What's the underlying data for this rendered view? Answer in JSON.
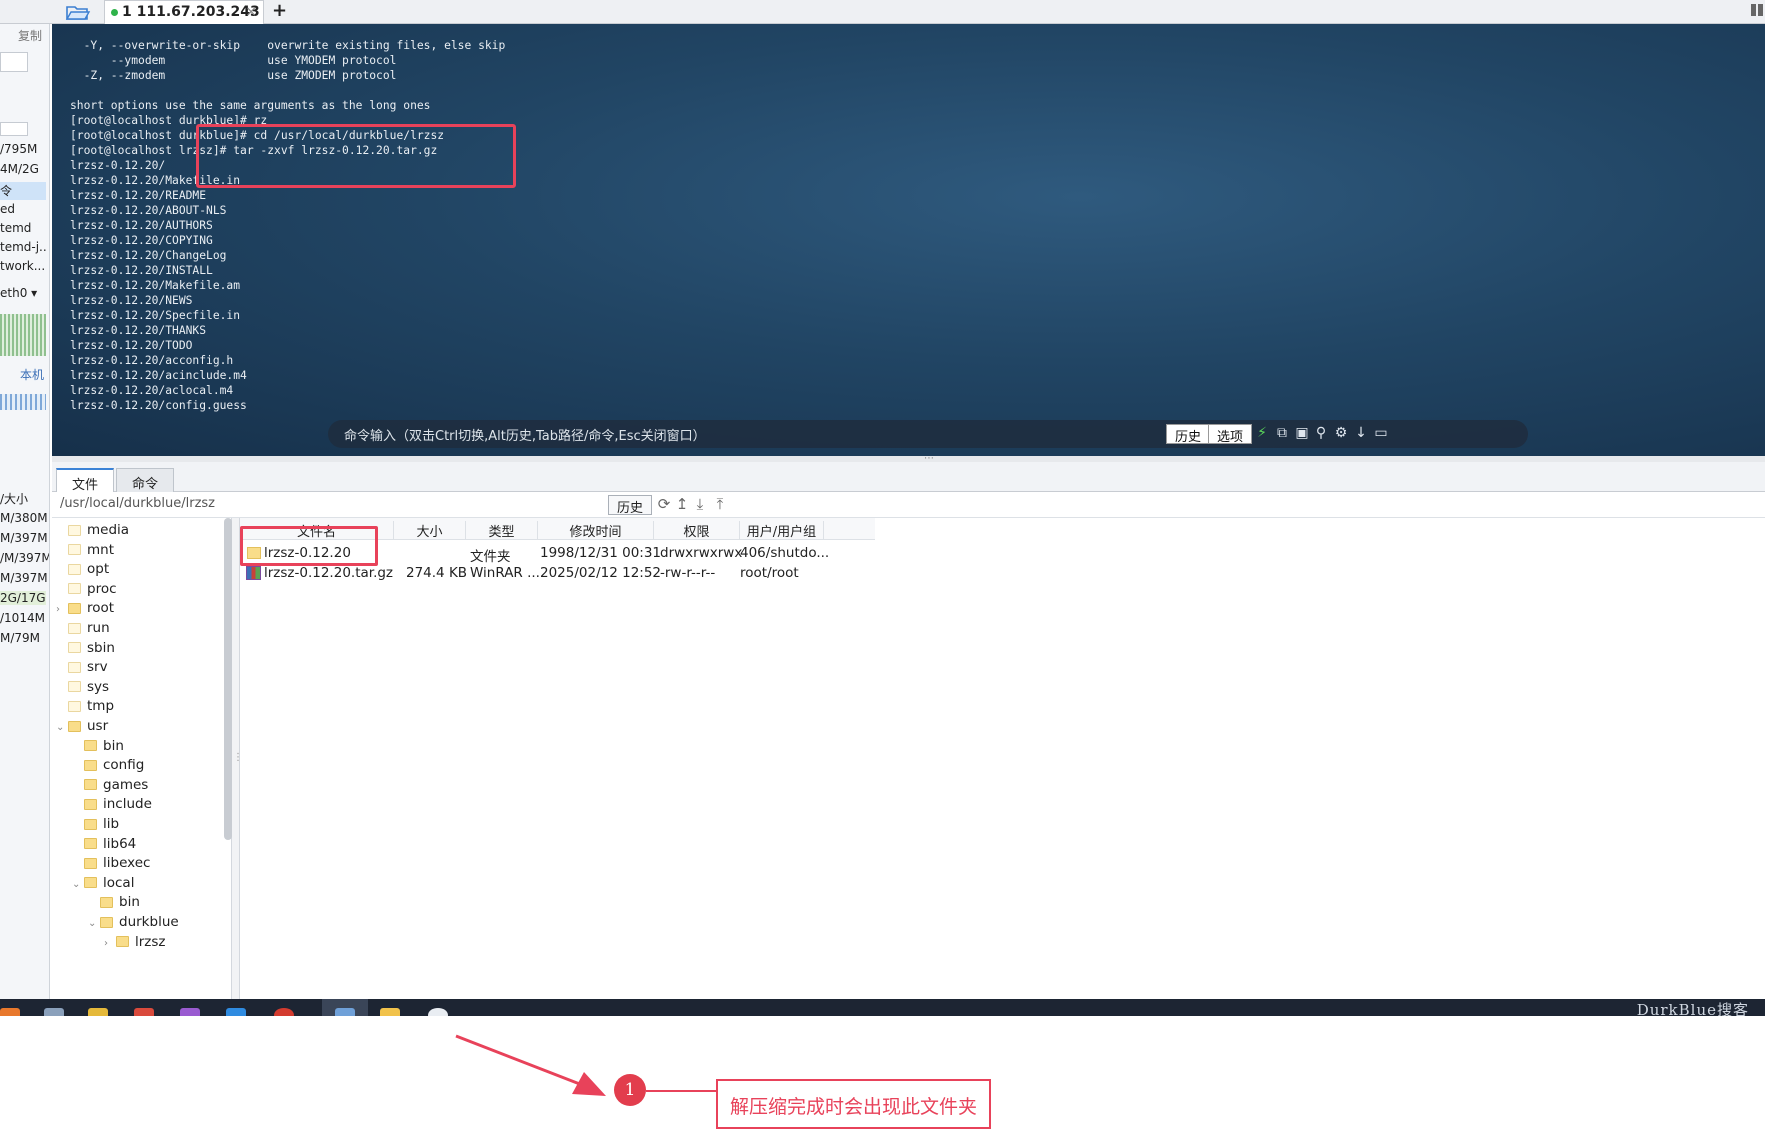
{
  "tabbar": {
    "session_index": "1",
    "session_host": "111.67.203.243",
    "close_glyph": "×",
    "add_glyph": "+"
  },
  "sysinfo": {
    "copy_label": "复制",
    "rows": [
      "/795M",
      "4M/2G",
      "令",
      "ed",
      "temd",
      "temd-j..",
      "twork..."
    ],
    "iface": "eth0",
    "local_label": "本机",
    "size_header": "/大小",
    "sizes": [
      "M/380M",
      "M/397M",
      "/M/397M",
      "M/397M",
      "2G/17G",
      "/1014M",
      "M/79M"
    ]
  },
  "terminal": {
    "lines": [
      "  -Y, --overwrite-or-skip    overwrite existing files, else skip",
      "      --ymodem               use YMODEM protocol",
      "  -Z, --zmodem               use ZMODEM protocol",
      "",
      "short options use the same arguments as the long ones",
      "[root@localhost durkblue]# rz",
      "[root@localhost durkblue]# cd /usr/local/durkblue/lrzsz",
      "[root@localhost lrzsz]# tar -zxvf lrzsz-0.12.20.tar.gz",
      "lrzsz-0.12.20/",
      "lrzsz-0.12.20/Makefile.in",
      "lrzsz-0.12.20/README",
      "lrzsz-0.12.20/ABOUT-NLS",
      "lrzsz-0.12.20/AUTHORS",
      "lrzsz-0.12.20/COPYING",
      "lrzsz-0.12.20/ChangeLog",
      "lrzsz-0.12.20/INSTALL",
      "lrzsz-0.12.20/Makefile.am",
      "lrzsz-0.12.20/NEWS",
      "lrzsz-0.12.20/Specfile.in",
      "lrzsz-0.12.20/THANKS",
      "lrzsz-0.12.20/TODO",
      "lrzsz-0.12.20/acconfig.h",
      "lrzsz-0.12.20/acinclude.m4",
      "lrzsz-0.12.20/aclocal.m4",
      "lrzsz-0.12.20/config.guess"
    ]
  },
  "cmdbar": {
    "hint": "命令输入（双击Ctrl切换,Alt历史,Tab路径/命令,Esc关闭窗口）",
    "history_label": "历史",
    "options_label": "选项",
    "icons": [
      "lightning-icon",
      "copy-icon",
      "paste-icon",
      "search-icon",
      "gear-icon",
      "download-arrow-icon",
      "maximize-icon"
    ]
  },
  "filepanel": {
    "tabs": [
      "文件",
      "命令"
    ],
    "path": "/usr/local/durkblue/lrzsz",
    "history_label": "历史",
    "tree": [
      {
        "name": "media",
        "level": 0,
        "arrow": ""
      },
      {
        "name": "mnt",
        "level": 0,
        "arrow": ""
      },
      {
        "name": "opt",
        "level": 0,
        "arrow": ""
      },
      {
        "name": "proc",
        "level": 0,
        "arrow": ""
      },
      {
        "name": "root",
        "level": 0,
        "arrow": "›"
      },
      {
        "name": "run",
        "level": 0,
        "arrow": ""
      },
      {
        "name": "sbin",
        "level": 0,
        "arrow": ""
      },
      {
        "name": "srv",
        "level": 0,
        "arrow": ""
      },
      {
        "name": "sys",
        "level": 0,
        "arrow": ""
      },
      {
        "name": "tmp",
        "level": 0,
        "arrow": ""
      },
      {
        "name": "usr",
        "level": 0,
        "arrow": "⌄"
      },
      {
        "name": "bin",
        "level": 1,
        "arrow": ""
      },
      {
        "name": "config",
        "level": 1,
        "arrow": ""
      },
      {
        "name": "games",
        "level": 1,
        "arrow": ""
      },
      {
        "name": "include",
        "level": 1,
        "arrow": ""
      },
      {
        "name": "lib",
        "level": 1,
        "arrow": ""
      },
      {
        "name": "lib64",
        "level": 1,
        "arrow": ""
      },
      {
        "name": "libexec",
        "level": 1,
        "arrow": ""
      },
      {
        "name": "local",
        "level": 1,
        "arrow": "⌄"
      },
      {
        "name": "bin",
        "level": 2,
        "arrow": ""
      },
      {
        "name": "durkblue",
        "level": 2,
        "arrow": "⌄"
      },
      {
        "name": "lrzsz",
        "level": 3,
        "arrow": "›"
      }
    ],
    "columns": [
      "文件名",
      "大小",
      "类型",
      "修改时间",
      "权限",
      "用户/用户组"
    ],
    "files": [
      {
        "name": "lrzsz-0.12.20",
        "size": "",
        "type": "文件夹",
        "mtime": "1998/12/31 00:31",
        "perm": "drwxrwxrwx",
        "owner": "406/shutdo...",
        "icon": "folder-icon"
      },
      {
        "name": "lrzsz-0.12.20.tar.gz",
        "size": "274.4 KB",
        "type": "WinRAR ...",
        "mtime": "2025/02/12 12:52",
        "perm": "-rw-r--r--",
        "owner": "root/root",
        "icon": "winrar-archive-icon"
      }
    ]
  },
  "annotation": {
    "number": "1",
    "text": "解压缩完成时会出现此文件夹",
    "color": "#e8425a"
  },
  "taskbar": {
    "watermark": "DurkBlue搜客"
  }
}
